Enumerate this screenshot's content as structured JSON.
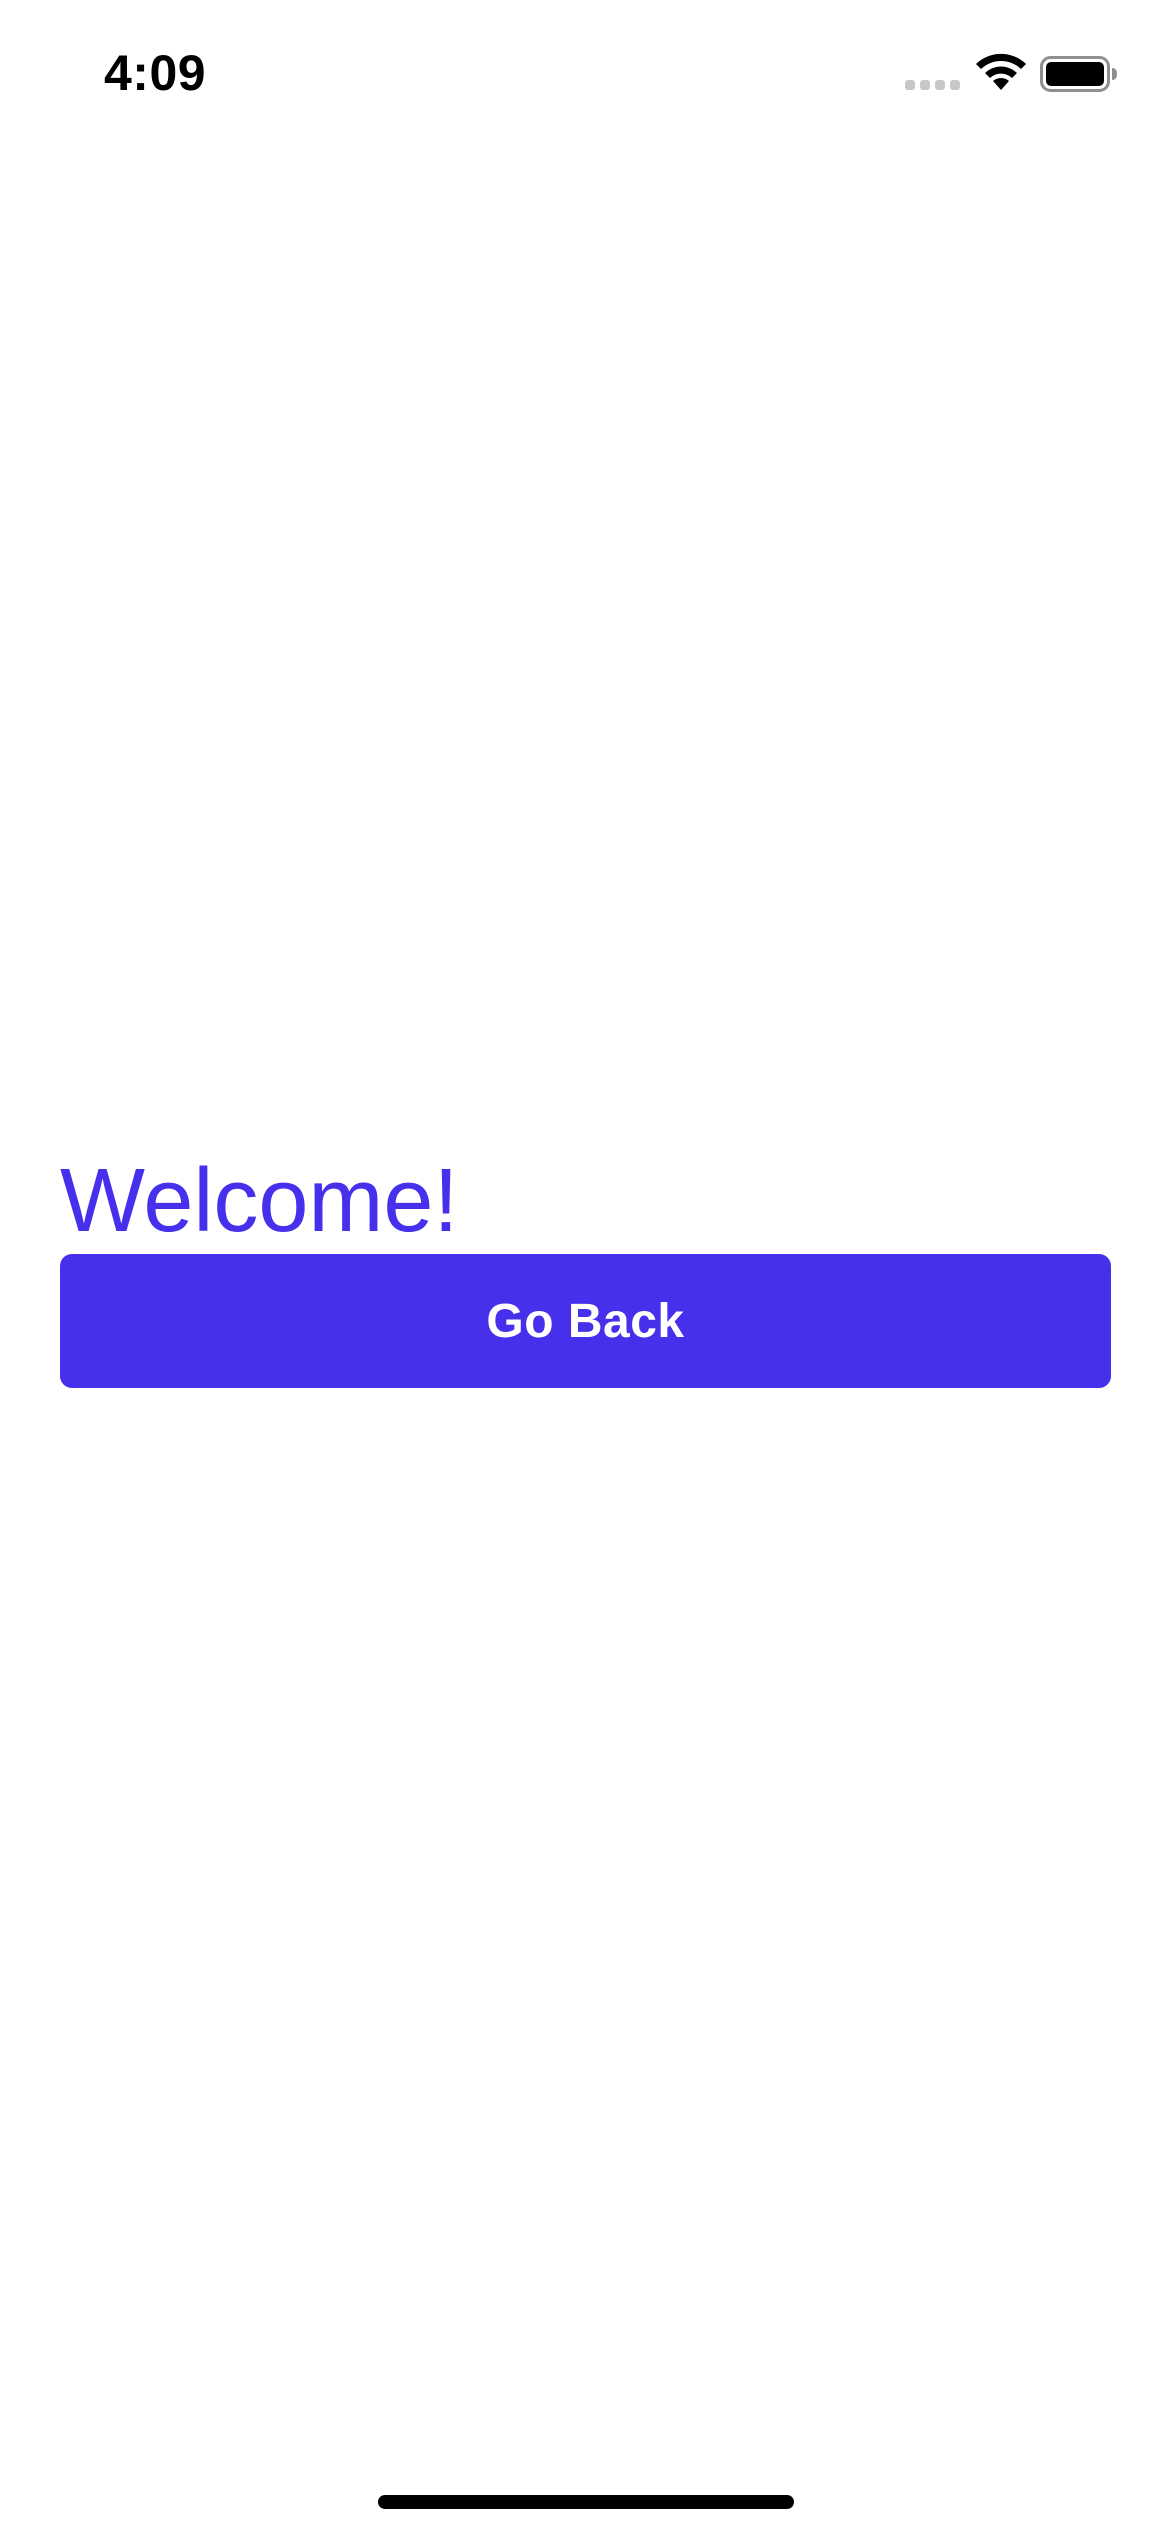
{
  "status_bar": {
    "time": "4:09",
    "signal_icon": "cellular-signal-dots-icon",
    "wifi_icon": "wifi-icon",
    "battery_icon": "battery-full-icon"
  },
  "main": {
    "title": "Welcome!",
    "go_back_label": "Go Back"
  },
  "colors": {
    "accent": "#4630eb",
    "background": "#ffffff",
    "button_text": "#ffffff",
    "status_text": "#000000"
  }
}
